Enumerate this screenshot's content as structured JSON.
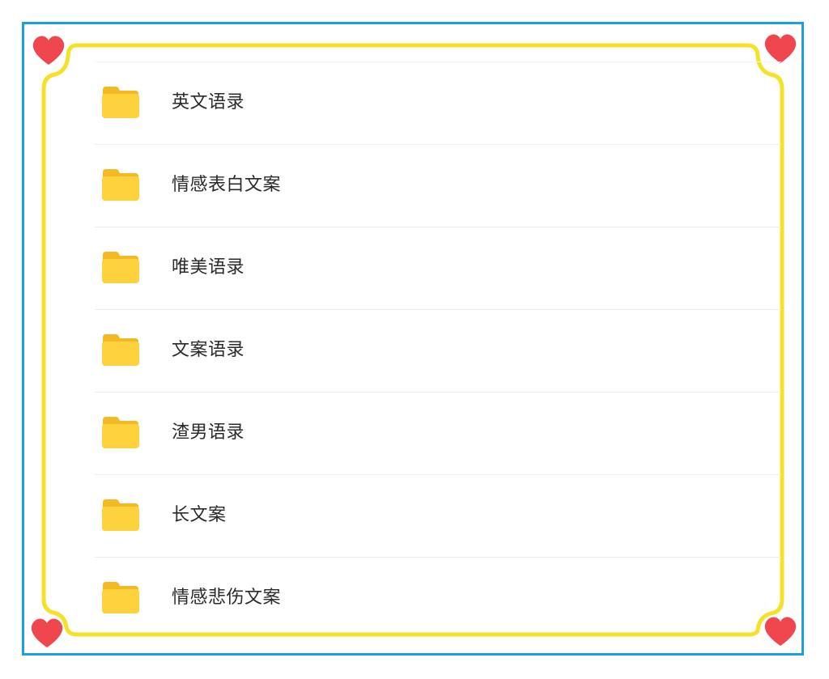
{
  "folders": [
    {
      "label": "英文语录",
      "icon": "folder-icon"
    },
    {
      "label": "情感表白文案",
      "icon": "folder-icon"
    },
    {
      "label": "唯美语录",
      "icon": "folder-icon"
    },
    {
      "label": "文案语录",
      "icon": "folder-icon"
    },
    {
      "label": "渣男语录",
      "icon": "folder-icon"
    },
    {
      "label": "长文案",
      "icon": "folder-icon"
    },
    {
      "label": "情感悲伤文案",
      "icon": "folder-icon"
    }
  ],
  "colors": {
    "outer_border": "#1aa0dc",
    "inner_border": "#f5e128",
    "heart": "#f0474f",
    "folder_front": "#fdd23c",
    "folder_back": "#f4b823",
    "text": "#2a2a2a"
  },
  "decorations": {
    "corner_icon": "heart-icon"
  }
}
